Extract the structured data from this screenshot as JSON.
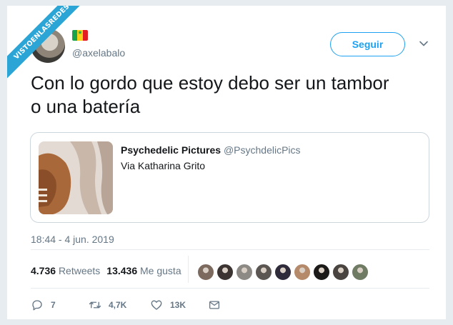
{
  "watermark": "VISTOENLASREDES",
  "author": {
    "handle": "@axelabalo"
  },
  "follow_label": "Seguir",
  "tweet": {
    "line1": "Con lo gordo que estoy debo ser un tambor",
    "line2": "o una batería"
  },
  "quoted": {
    "name": "Psychedelic Pictures",
    "handle": "@PsychdelicPics",
    "text": "Via Katharina Grito"
  },
  "timestamp": "18:44 - 4 jun. 2019",
  "stats": {
    "retweets_count": "4.736",
    "retweets_label": "Retweets",
    "likes_count": "13.436",
    "likes_label": "Me gusta"
  },
  "liker_colors": [
    "#7d6a5e",
    "#3b3433",
    "#8d8a86",
    "#5b5651",
    "#2f2b3a",
    "#b58a6a",
    "#1b1a19",
    "#4a4440",
    "#6f7b62"
  ],
  "actions": {
    "replies": "7",
    "retweets": "4,7K",
    "likes": "13K"
  },
  "colors": {
    "accent": "#1da1f2",
    "muted": "#657786",
    "ribbon": "#2aa5d6"
  }
}
